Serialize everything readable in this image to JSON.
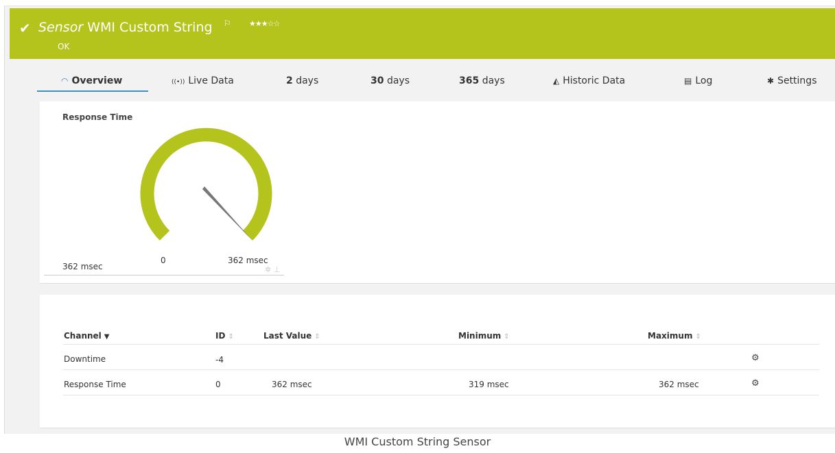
{
  "header": {
    "sensor_kind": "Sensor",
    "sensor_name": "WMI Custom String",
    "flag_icon": "flag-icon",
    "stars": "★★★☆☆",
    "status": "OK",
    "color": "#b4c41c"
  },
  "tabs": [
    {
      "label": "Overview",
      "icon": "gauge-icon",
      "active": true
    },
    {
      "label": "Live Data",
      "icon": "live-icon"
    },
    {
      "bold": "2",
      "label": "days"
    },
    {
      "bold": "30",
      "label": "days"
    },
    {
      "bold": "365",
      "label": "days"
    },
    {
      "label": "Historic Data",
      "icon": "area-chart-icon"
    },
    {
      "label": "Log",
      "icon": "log-icon"
    },
    {
      "label": "Settings",
      "icon": "gear-icon"
    }
  ],
  "gauge": {
    "title": "Response Time",
    "value": "362 msec",
    "min_label": "0",
    "max_label": "362 msec",
    "fill_fraction": 1.0
  },
  "table": {
    "headers": {
      "channel": "Channel",
      "id": "ID",
      "last": "Last Value",
      "min": "Minimum",
      "max": "Maximum"
    },
    "rows": [
      {
        "channel": "Downtime",
        "id": "-4",
        "last": "",
        "min": "",
        "max": ""
      },
      {
        "channel": "Response Time",
        "id": "0",
        "last": "362 msec",
        "min": "319 msec",
        "max": "362 msec"
      }
    ]
  },
  "caption": "WMI Custom String Sensor"
}
